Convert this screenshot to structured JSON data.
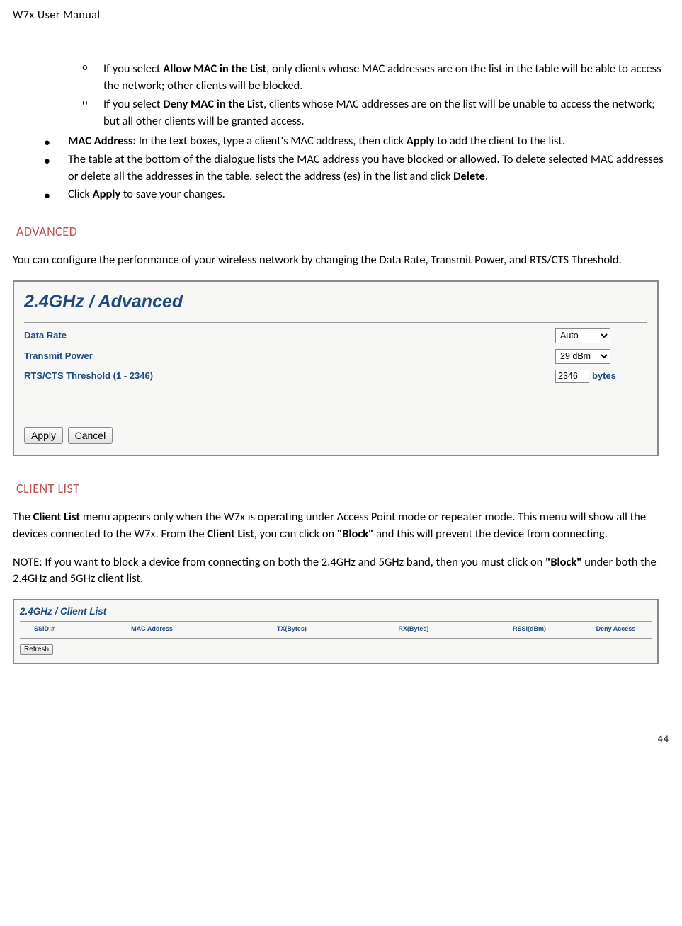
{
  "header": {
    "title": "W7x  User Manual"
  },
  "list": {
    "sub1_pre": "If you select ",
    "sub1_bold": "Allow MAC in the List",
    "sub1_post": ", only clients whose MAC addresses are on the list in the table will be able to access the network; other clients will be blocked.",
    "sub2_pre": "If you select ",
    "sub2_bold": "Deny MAC in the List",
    "sub2_post": ", clients whose MAC addresses are on the list will be unable to access the network; but all other clients will be granted access.",
    "b1_bold": "MAC Address:",
    "b1_text": " In the text boxes, type a client's MAC address, then click ",
    "b1_bold2": "Apply",
    "b1_tail": " to add the client to the list.",
    "b2_text1": "The table at the bottom of the dialogue lists the MAC address you have blocked or allowed. To delete selected MAC addresses or delete all the addresses in the table, select the address (es) in the list and click ",
    "b2_bold": "Delete",
    "b2_tail": ".",
    "b3_text": "Click ",
    "b3_bold": "Apply",
    "b3_tail": " to save your changes."
  },
  "advanced": {
    "heading": "ADVANCED",
    "para": "You can configure the performance of your wireless network by changing the Data Rate, Transmit Power, and RTS/CTS Threshold.",
    "shot_title": "2.4GHz / Advanced",
    "row1_label": "Data Rate",
    "row1_value": "Auto",
    "row2_label": "Transmit Power",
    "row2_value": "29 dBm",
    "row3_label": "RTS/CTS Threshold (1 - 2346)",
    "row3_value": "2346",
    "row3_unit": "bytes",
    "btn_apply": "Apply",
    "btn_cancel": "Cancel"
  },
  "clientlist": {
    "heading": "CLIENT LIST",
    "p1_a": "The ",
    "p1_b": "Client List",
    "p1_c": " menu appears only when the W7x is operating under Access Point mode or repeater mode. This menu will show all the devices connected to the W7x. From the ",
    "p1_d": "Client List",
    "p1_e": ", you can click on ",
    "p1_f": "\"Block\"",
    "p1_g": " and this will prevent the device from connecting.",
    "p2_a": "NOTE: If you want to block a device from connecting on both the 2.4GHz and 5GHz band, then you must click on ",
    "p2_b": "\"Block\"",
    "p2_c": " under both the 2.4GHz and 5GHz client list.",
    "shot_title": "2.4GHz / Client List",
    "h1": "SSID:#",
    "h2": "MAC Address",
    "h3": "TX(Bytes)",
    "h4": "RX(Bytes)",
    "h5": "RSSI(dBm)",
    "h6": "Deny Access",
    "btn_refresh": "Refresh"
  },
  "footer": {
    "page": "44"
  }
}
